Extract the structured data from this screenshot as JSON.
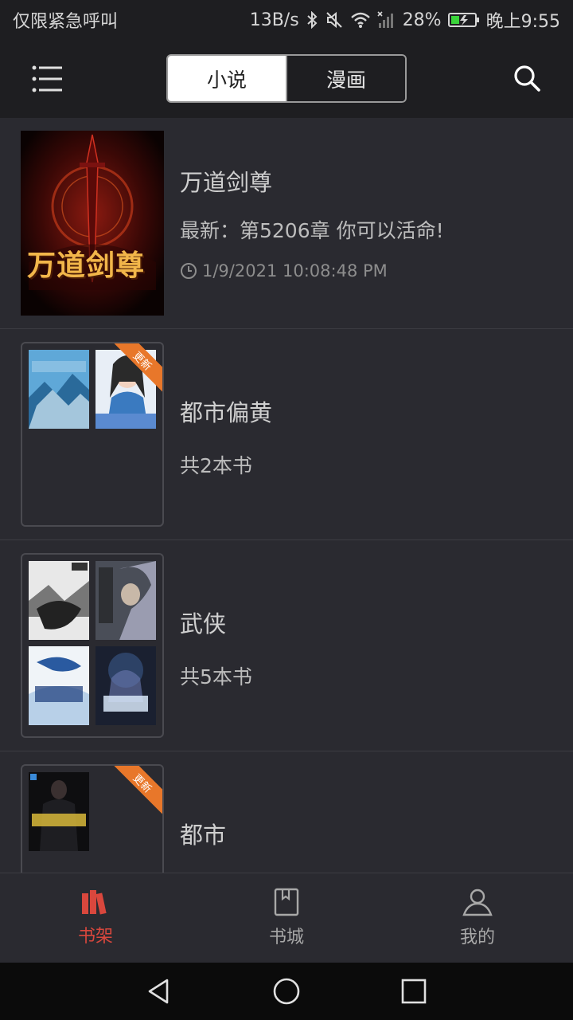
{
  "status_bar": {
    "carrier_text": "仅限紧急呼叫",
    "network_speed": "13B/s",
    "battery_percent": "28%",
    "time": "晚上9:55"
  },
  "header": {
    "tabs": [
      {
        "label": "小说",
        "active": true
      },
      {
        "label": "漫画",
        "active": false
      }
    ],
    "menu_icon": "menu-icon",
    "search_icon": "search-icon"
  },
  "shelf": {
    "items": [
      {
        "type": "book",
        "title": "万道剑尊",
        "latest": "最新：第5206章 你可以活命!",
        "timestamp": "1/9/2021 10:08:48 PM",
        "cover_title": "万道剑尊"
      },
      {
        "type": "group",
        "title": "都市偏黄",
        "count": "共2本书",
        "badge": "更新"
      },
      {
        "type": "group",
        "title": "武侠",
        "count": "共5本书"
      },
      {
        "type": "group",
        "title": "都市",
        "badge": "更新"
      }
    ]
  },
  "bottom_nav": {
    "items": [
      {
        "label": "书架",
        "icon": "bookshelf-icon",
        "active": true
      },
      {
        "label": "书城",
        "icon": "book-icon",
        "active": false
      },
      {
        "label": "我的",
        "icon": "user-icon",
        "active": false
      }
    ]
  },
  "colors": {
    "accent": "#d9473d",
    "badge": "#e8772a",
    "background": "#2a2a30",
    "topbar": "#1e1e21"
  }
}
